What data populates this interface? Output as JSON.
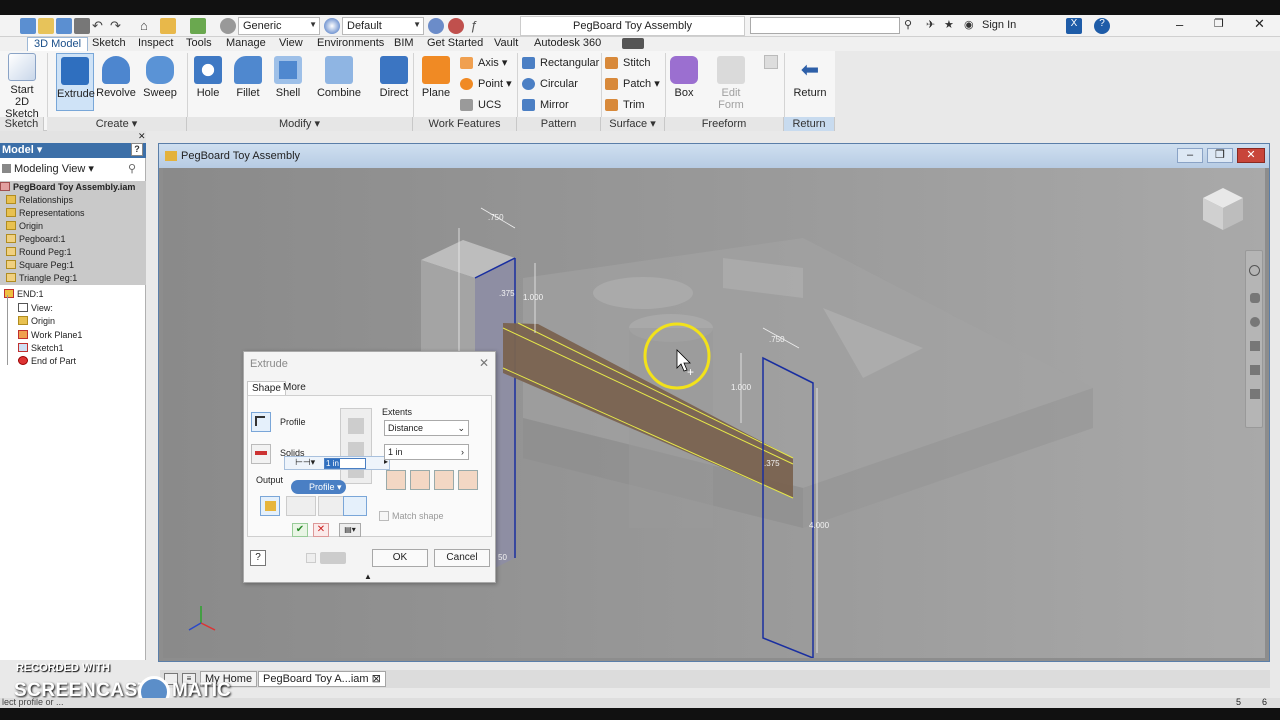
{
  "window": {
    "title": "PegBoard Toy Assembly",
    "sign_in": "Sign In",
    "material_combo": "Generic",
    "appearance_combo": "Default"
  },
  "menu_tabs": [
    "3D Model",
    "Sketch",
    "Inspect",
    "Tools",
    "Manage",
    "View",
    "Environments",
    "BIM",
    "Get Started",
    "Vault",
    "Autodesk 360"
  ],
  "ribbon": {
    "sketch": {
      "start_label": "Start",
      "start_sub": "2D Sketch",
      "panel": "Sketch"
    },
    "create": {
      "extrude": "Extrude",
      "revolve": "Revolve",
      "sweep": "Sweep",
      "panel": "Create"
    },
    "modify": {
      "hole": "Hole",
      "fillet": "Fillet",
      "shell": "Shell",
      "combine": "Combine",
      "direct": "Direct",
      "panel": "Modify"
    },
    "work_features": {
      "plane": "Plane",
      "axis": "Axis",
      "point": "Point",
      "ucs": "UCS",
      "panel": "Work Features"
    },
    "pattern": {
      "rectangular": "Rectangular",
      "circular": "Circular",
      "mirror": "Mirror",
      "panel": "Pattern"
    },
    "surface": {
      "stitch": "Stitch",
      "patch": "Patch",
      "trim": "Trim",
      "panel": "Surface"
    },
    "freeform": {
      "box": "Box",
      "edit_form": "Edit",
      "edit_form_sub": "Form",
      "panel": "Freeform"
    },
    "return": {
      "return": "Return",
      "panel": "Return"
    }
  },
  "browser": {
    "header": "Model",
    "view": "Modeling View",
    "items": [
      "PegBoard Toy Assembly.iam",
      "Relationships",
      "Representations",
      "Origin",
      "Pegboard:1",
      "Round Peg:1",
      "Square Peg:1",
      "Triangle Peg:1",
      "END:1",
      "View:",
      "Origin",
      "Work Plane1",
      "Sketch1",
      "End of Part"
    ]
  },
  "document": {
    "title": "PegBoard Toy Assembly"
  },
  "dimensions": {
    "d1": ".750",
    "d2": "1.000",
    "d3": ".375",
    "d4": ".750",
    "d5": "1.000",
    "d6": ".375",
    "d7": "4.000",
    "d8": "50"
  },
  "extrude_dialog": {
    "title": "Extrude",
    "tab_shape": "Shape",
    "tab_more": "More",
    "profile": "Profile",
    "solids": "Solids",
    "output": "Output",
    "extents": "Extents",
    "extents_mode": "Distance",
    "distance": "1 in",
    "input_value": "1 in",
    "profile_chip": "Profile",
    "match_shape": "Match shape",
    "ok": "OK",
    "cancel": "Cancel"
  },
  "doc_tabs": {
    "home": "My Home",
    "doc": "PegBoard Toy A...iam"
  },
  "watermark": {
    "line1": "RECORDED WITH",
    "line2": "SCREENCAST",
    "line3": "MATIC"
  },
  "status": {
    "text": "lect profile or ...",
    "n1": "5",
    "n2": "6"
  }
}
